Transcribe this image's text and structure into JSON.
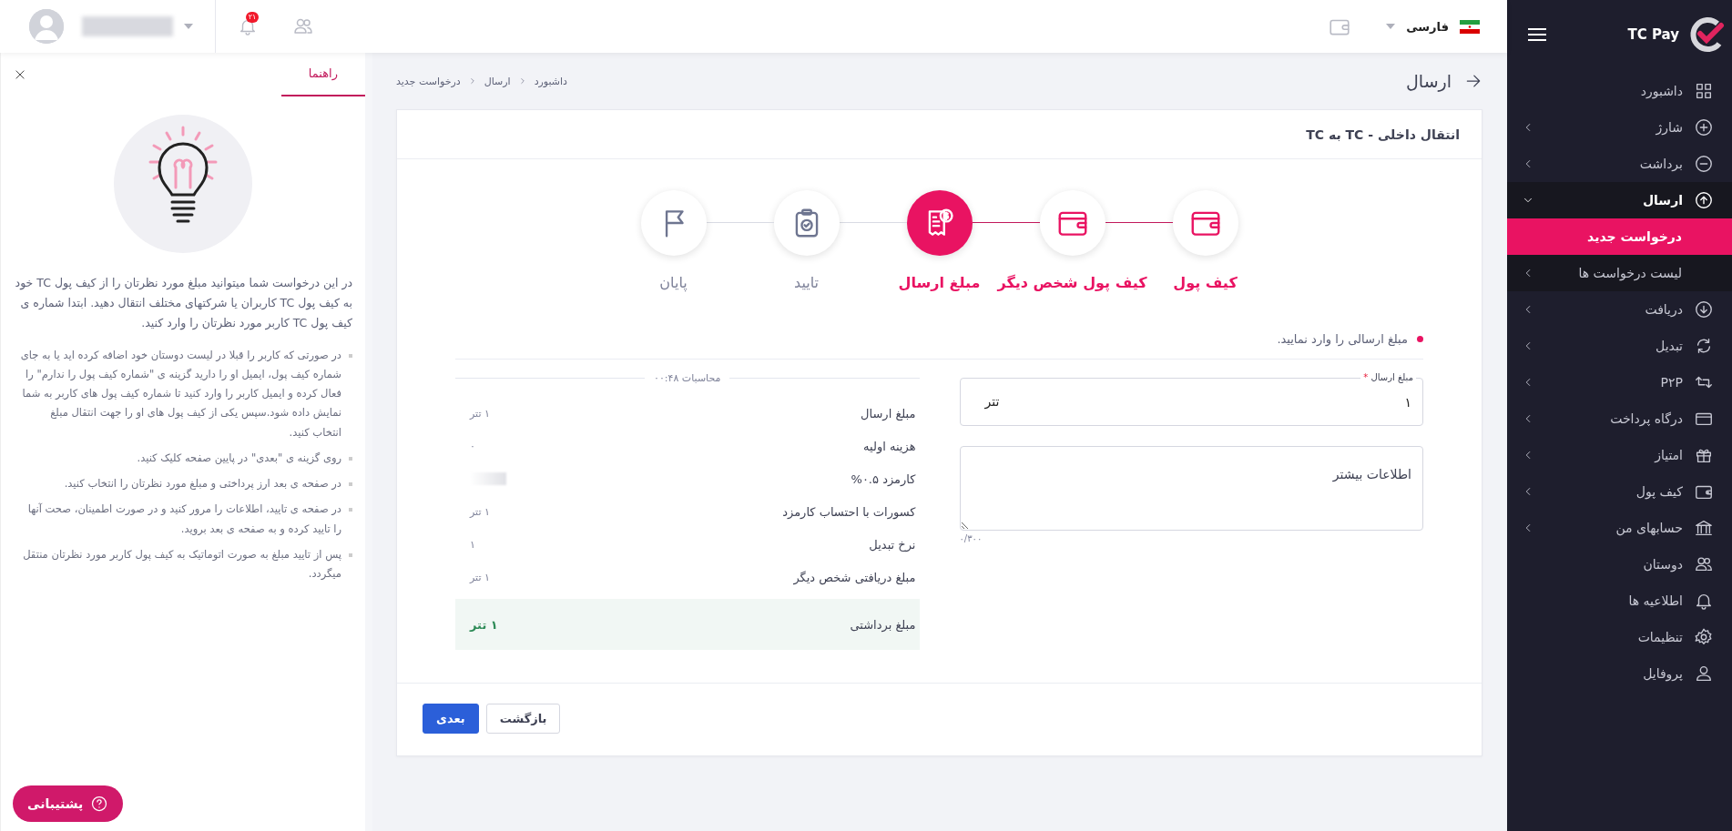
{
  "sidebar": {
    "brand": "TC Pay",
    "items": [
      {
        "label": "داشبورد",
        "kind": "link",
        "selected": false
      },
      {
        "label": "شارژ",
        "kind": "group",
        "expanded": false,
        "selected": false
      },
      {
        "label": "برداشت",
        "kind": "group",
        "expanded": false,
        "selected": false
      },
      {
        "label": "ارسال",
        "kind": "group",
        "expanded": true,
        "selected": true,
        "children": [
          {
            "label": "درخواست جدید",
            "selected": true
          },
          {
            "label": "لیست درخواست ها",
            "selected": false
          }
        ]
      },
      {
        "label": "دریافت",
        "kind": "group",
        "expanded": false,
        "selected": false
      },
      {
        "label": "تبدیل",
        "kind": "group",
        "expanded": false,
        "selected": false
      },
      {
        "label": "P۲P",
        "kind": "group",
        "expanded": false,
        "selected": false
      },
      {
        "label": "درگاه پرداخت",
        "kind": "group",
        "expanded": false,
        "selected": false
      },
      {
        "label": "امتیاز",
        "kind": "group",
        "expanded": false,
        "selected": false
      },
      {
        "label": "کیف پول",
        "kind": "group",
        "expanded": false,
        "selected": false
      },
      {
        "label": "حسابهای من",
        "kind": "group",
        "expanded": false,
        "selected": false
      },
      {
        "label": "دوستان",
        "kind": "link",
        "selected": false
      },
      {
        "label": "اطلاعیه ها",
        "kind": "link",
        "selected": false
      },
      {
        "label": "تنظیمات",
        "kind": "link",
        "selected": false
      },
      {
        "label": "پروفایل",
        "kind": "link",
        "selected": false
      }
    ]
  },
  "topbar": {
    "language": "فارسی",
    "notification_count": "۲۱"
  },
  "page": {
    "title": "ارسال",
    "breadcrumb": [
      "داشبورد",
      "ارسال",
      "درخواست جدید"
    ]
  },
  "card": {
    "title": "انتقال داخلی - TC به TC",
    "steps": [
      {
        "label": "کیف پول",
        "done": true,
        "selected": false
      },
      {
        "label": "کیف پول شخص دیگر",
        "done": true,
        "selected": false
      },
      {
        "label": "مبلغ ارسال",
        "done": false,
        "selected": true
      },
      {
        "label": "تایید",
        "done": false,
        "selected": false
      },
      {
        "label": "پایان",
        "done": false,
        "selected": false
      }
    ],
    "instruction": "مبلغ ارسالی را وارد نمایید.",
    "amount_field": {
      "label": "مبلغ ارسال",
      "required_mark": "*",
      "value": "۱",
      "unit": "تتر"
    },
    "notes_field": {
      "placeholder": "اطلاعات بیشتر",
      "counter": "۰/۳۰۰"
    },
    "calculation": {
      "title": "محاسبات ۰۰:۴۸",
      "rows": [
        {
          "label": "مبلغ ارسال",
          "value": "۱ تتر",
          "kind": "plain"
        },
        {
          "label": "هزینه اولیه",
          "value": "۰",
          "kind": "plain"
        },
        {
          "label": "کارمزد ۰.۵%",
          "kind": "blurred"
        },
        {
          "label": "کسورات با احتساب کارمزد",
          "value": "۱ تتر",
          "kind": "plain"
        },
        {
          "label": "نرخ تبدیل",
          "value": "۱",
          "kind": "plain"
        },
        {
          "label": "مبلغ دریافتی شخص دیگر",
          "value": "۱ تتر",
          "kind": "plain"
        },
        {
          "label": "مبلغ برداشتی",
          "value": "۱ تتر",
          "kind": "total"
        }
      ]
    },
    "buttons": {
      "back": "بازگشت",
      "next": "بعدی"
    }
  },
  "help": {
    "tab": {
      "label": "راهنما",
      "selected": true
    },
    "intro": "در این درخواست شما میتوانید مبلغ مورد نظرتان را از کیف پول TC خود به کیف پول TC کاربران یا شرکتهای مختلف انتقال دهید. ابتدا شماره ی کیف پول TC کاربر مورد نظرتان را وارد کنید.",
    "bullets": [
      "در صورتی که کاربر را قبلا در لیست دوستان خود اضافه کرده اید یا به جای شماره کیف پول، ایمیل او را دارید گزینه ی \"شماره کیف پول را ندارم\" را فعال کرده و ایمیل کاربر را وارد کنید تا شماره کیف پول های کاربر به شما نمایش داده شود.سپس یکی از کیف پول های او را جهت انتقال مبلغ انتخاب کنید.",
      "روی گزینه ی \"بعدی\" در پایین صفحه کلیک کنید.",
      "در صفحه ی بعد ارز پرداختی و مبلغ مورد نظرتان را انتخاب کنید.",
      "در صفحه ی تایید، اطلاعات را مرور کنید و در صورت اطمینان، صحت آنها را تایید کرده و به صفحه ی بعد بروید.",
      "پس از تایید مبلغ به صورت اتوماتیک به کیف پول کاربر مورد نظرتان منتقل میگردد."
    ],
    "support": "پشتیبانی"
  }
}
